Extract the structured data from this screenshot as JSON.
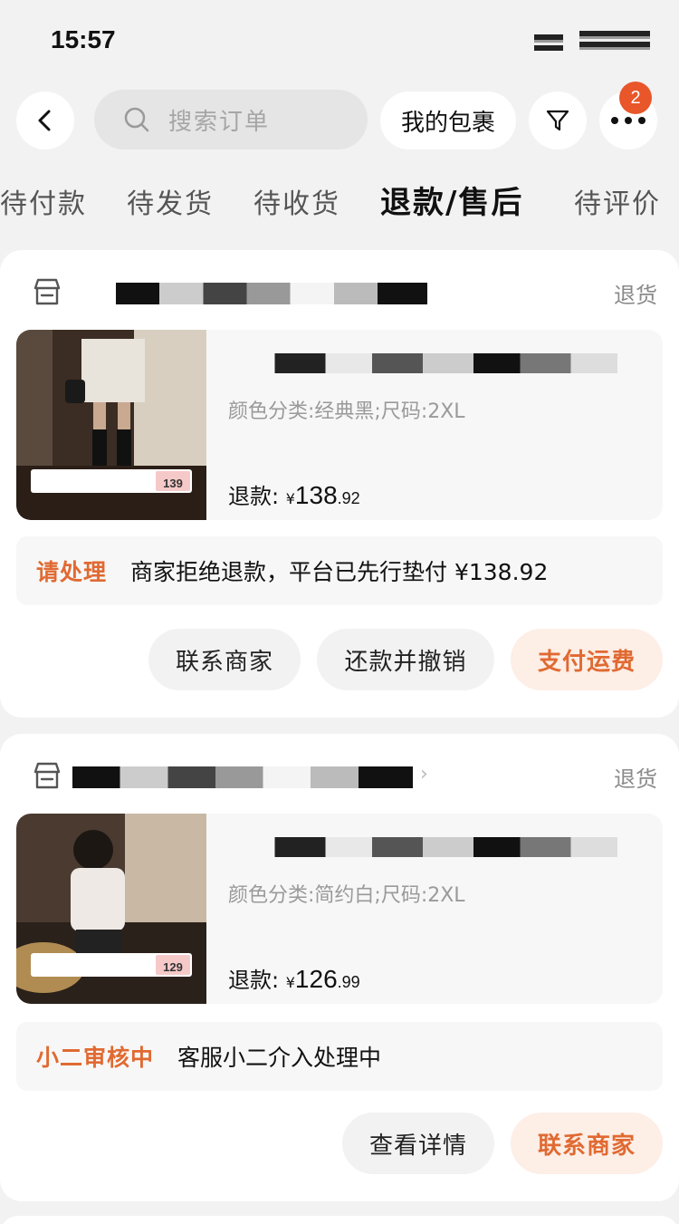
{
  "status_bar": {
    "time": "15:57"
  },
  "topbar": {
    "search_placeholder": "搜索订单",
    "parcel_label": "我的包裹",
    "badge_count": "2"
  },
  "tabs": [
    {
      "label": "待付款"
    },
    {
      "label": "待发货"
    },
    {
      "label": "待收货"
    },
    {
      "label": "退款/售后"
    },
    {
      "label": "待评价"
    }
  ],
  "orders": [
    {
      "return_type": "退货",
      "spec": "颜色分类:经典黑;尺码:2XL",
      "refund_label": "退款:",
      "currency": "¥",
      "amount_int": "138",
      "amount_dec": ".92",
      "thumb_price": "139",
      "notice_tag": "请处理",
      "notice_text": "商家拒绝退款，平台已先行垫付 ¥138.92",
      "buttons": [
        "联系商家",
        "还款并撤销",
        "支付运费"
      ]
    },
    {
      "return_type": "退货",
      "spec": "颜色分类:简约白;尺码:2XL",
      "refund_label": "退款:",
      "currency": "¥",
      "amount_int": "126",
      "amount_dec": ".99",
      "thumb_price": "129",
      "notice_tag": "小二审核中",
      "notice_text": "客服小二介入处理中",
      "buttons": [
        "查看详情",
        "联系商家"
      ]
    }
  ],
  "colors": {
    "accent": "#e06a32",
    "badge": "#e8562a",
    "page_bg": "#f2f2f2"
  }
}
